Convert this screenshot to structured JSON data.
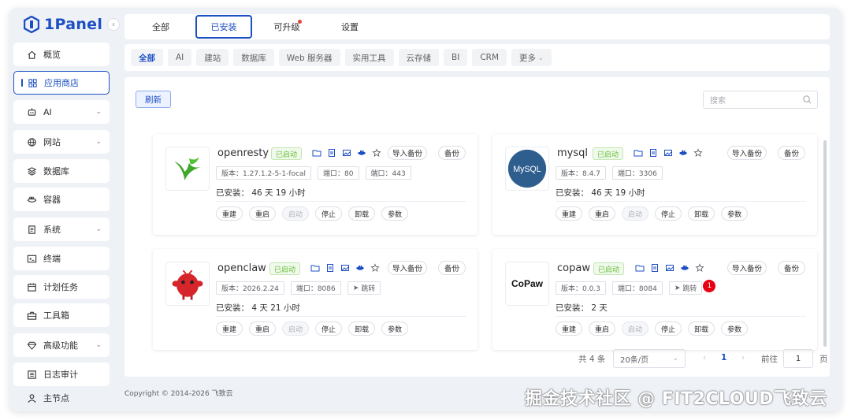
{
  "app": {
    "brand": "1Panel",
    "accent": "#1c4fc4"
  },
  "sidebar": {
    "items": [
      {
        "label": "概览",
        "icon": "home-icon"
      },
      {
        "label": "应用商店",
        "icon": "grid-icon",
        "active": true
      },
      {
        "label": "AI",
        "icon": "robot-icon",
        "expandable": true
      },
      {
        "label": "网站",
        "icon": "globe-icon",
        "expandable": true
      },
      {
        "label": "数据库",
        "icon": "layers-icon"
      },
      {
        "label": "容器",
        "icon": "container-icon"
      },
      {
        "label": "系统",
        "icon": "document-icon",
        "expandable": true
      },
      {
        "label": "终端",
        "icon": "terminal-icon"
      },
      {
        "label": "计划任务",
        "icon": "calendar-icon"
      },
      {
        "label": "工具箱",
        "icon": "toolbox-icon"
      },
      {
        "label": "高级功能",
        "icon": "diamond-icon",
        "expandable": true
      },
      {
        "label": "日志审计",
        "icon": "log-icon"
      },
      {
        "label": "主节点",
        "icon": "user-icon"
      }
    ]
  },
  "tabs": [
    {
      "label": "全部"
    },
    {
      "label": "已安装",
      "active": true
    },
    {
      "label": "可升级",
      "dot": true
    },
    {
      "label": "设置"
    }
  ],
  "categories": [
    "全部",
    "AI",
    "建站",
    "数据库",
    "Web 服务器",
    "实用工具",
    "云存储",
    "BI",
    "CRM",
    "更多"
  ],
  "toolbar": {
    "refresh_label": "刷新",
    "search_placeholder": "搜索"
  },
  "card_labels": {
    "running": "已启动",
    "import_backup": "导入备份",
    "backup": "备份",
    "actions": [
      "重建",
      "重启",
      "启动",
      "停止",
      "卸载",
      "参数"
    ]
  },
  "apps": [
    {
      "name": "openresty",
      "version": "版本：1.27.1.2-5-1-focal",
      "ports": [
        "端口：80",
        "端口：443"
      ],
      "installed": "已安装：  46 天 19 小时"
    },
    {
      "name": "mysql",
      "version": "版本：8.4.7",
      "ports": [
        "端口：3306"
      ],
      "installed": "已安装：  46 天 19 小时"
    },
    {
      "name": "openclaw",
      "version": "版本：2026.2.24",
      "ports": [
        "端口：8086"
      ],
      "jump": "跳转",
      "installed": "已安装：  4 天 21 小时"
    },
    {
      "name": "copaw",
      "version": "版本：0.0.3",
      "ports": [
        "端口：8084"
      ],
      "jump": "跳转",
      "jump_badge": "1",
      "installed": "已安装：  2 天"
    }
  ],
  "logos": {
    "mysql_text": "MySQL",
    "copaw_text": "CoPaw"
  },
  "pagination": {
    "total": "共 4 条",
    "page_size": "20条/页",
    "current": "1",
    "goto_label": "前往",
    "goto_value": "1",
    "page_unit": "页"
  },
  "footer": {
    "copyright": "Copyright © 2014-2026 飞致云"
  },
  "watermark": "掘金技术社区 @ FIT2CLOUD飞致云"
}
